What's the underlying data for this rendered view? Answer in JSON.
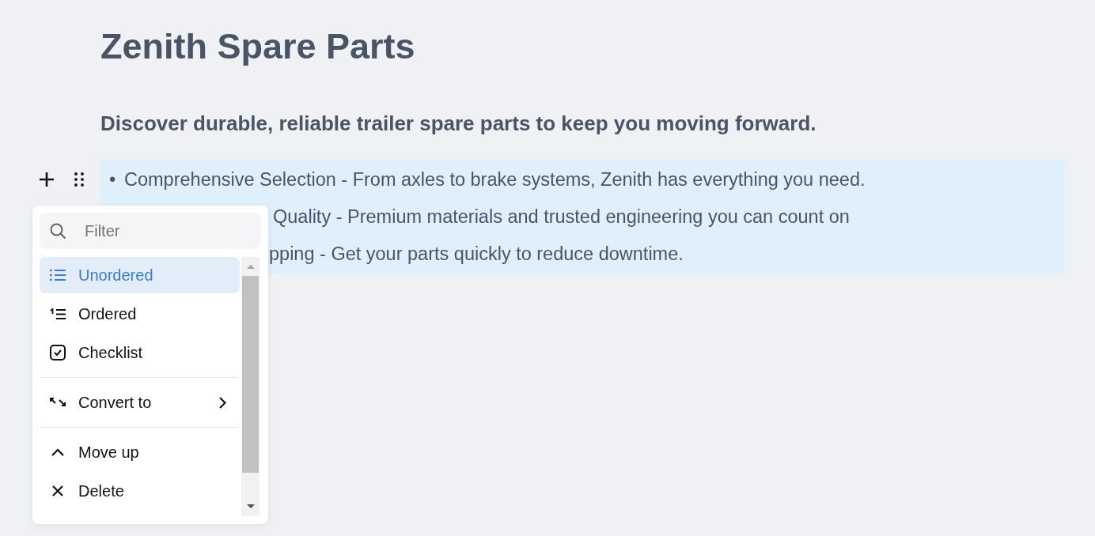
{
  "page": {
    "title": "Zenith Spare Parts",
    "subtitle": "Discover durable, reliable trailer spare parts to keep you moving forward."
  },
  "list": {
    "selected": true,
    "items": [
      {
        "marker": "•",
        "text": "Comprehensive Selection - From axles to brake systems, Zenith has everything you need."
      },
      {
        "text": "Quality - Premium materials and trusted engineering you can count on"
      },
      {
        "text": "pping - Get your parts quickly to reduce downtime."
      }
    ]
  },
  "menu": {
    "filter": {
      "placeholder": "Filter"
    },
    "groups": [
      {
        "items": [
          {
            "label": "Unordered",
            "selected": true,
            "has_submenu": false
          },
          {
            "label": "Ordered",
            "selected": false,
            "has_submenu": false
          },
          {
            "label": "Checklist",
            "selected": false,
            "has_submenu": false
          }
        ]
      },
      {
        "items": [
          {
            "label": "Convert to",
            "selected": false,
            "has_submenu": true
          }
        ]
      },
      {
        "items": [
          {
            "label": "Move up",
            "selected": false,
            "has_submenu": false
          },
          {
            "label": "Delete",
            "selected": false,
            "has_submenu": false
          }
        ]
      }
    ]
  }
}
